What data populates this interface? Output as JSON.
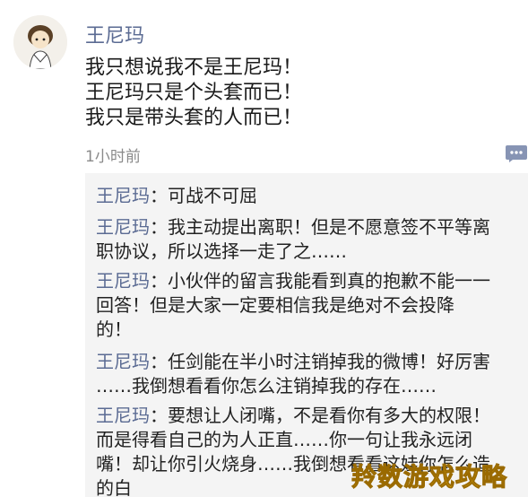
{
  "post": {
    "author": "王尼玛",
    "lines": [
      "我只想说我不是王尼玛！",
      "王尼玛只是个头套而已！",
      "我只是带头套的人而已！"
    ],
    "time": "1小时前"
  },
  "comments": [
    {
      "name": "王尼玛",
      "lines": [
        "：可战不可屈"
      ]
    },
    {
      "name": "王尼玛",
      "lines": [
        "：我主动提出离职！但是不愿意签不平等离",
        "职协议，所以选择一走了之……"
      ]
    },
    {
      "name": "王尼玛",
      "lines": [
        "：小伙伴的留言我能看到真的抱歉不能一一",
        "回答！但是大家一定要相信我是绝对不会投降",
        "的！"
      ]
    },
    {
      "name": "王尼玛",
      "lines": [
        "：任剑能在半小时注销掉我的微博！好厉害",
        "……我倒想看看你怎么注销掉我的存在……"
      ]
    },
    {
      "name": "王尼玛",
      "lines": [
        "：要想让人闭嘴，不是看你有多大的权限！",
        "而是得看自己的为人正直……你一句让我永远闭",
        "嘴！却让你引火烧身……我倒想看看这娃你怎么造",
        "的白"
      ]
    }
  ],
  "watermark": "羚数游戏攻略",
  "icons": {
    "avatar": "cartoon-avatar-icon",
    "comment": "comment-icon"
  },
  "colors": {
    "name": "#5b6b93",
    "text": "#1a1a1a",
    "time": "#8a8a8a",
    "comment_bg": "#f4f4f4",
    "watermark": "#f7c215"
  }
}
